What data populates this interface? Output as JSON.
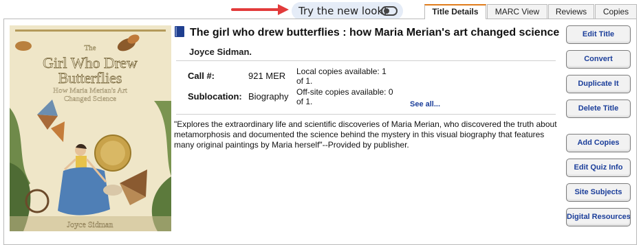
{
  "header": {
    "try_new_look": "Try the new look!",
    "toggle_state": "off"
  },
  "tabs": [
    {
      "label": "Title Details",
      "active": true
    },
    {
      "label": "MARC View",
      "active": false
    },
    {
      "label": "Reviews",
      "active": false
    },
    {
      "label": "Copies",
      "active": false
    }
  ],
  "cover": {
    "line1": "The",
    "line2": "Girl Who Drew",
    "line3": "Butterflies",
    "subtitle1": "How Maria Merian's Art",
    "subtitle2": "Changed Science",
    "author": "Joyce Sidman"
  },
  "record": {
    "title": "The girl who drew butterflies : how Maria Merian's art changed science",
    "author": "Joyce Sidman.",
    "call_label": "Call #:",
    "call_value": "921 MER",
    "subloc_label": "Sublocation:",
    "subloc_value": "Biography",
    "local_copies_1": "Local copies available: 1",
    "local_copies_2": "of 1.",
    "offsite_copies_1": "Off-site copies available: 0",
    "offsite_copies_2": "of 1.",
    "see_all": "See all...",
    "summary": "\"Explores the extraordinary life and scientific discoveries of Maria Merian, who discovered the truth about metamorphosis and documented the science behind the mystery in this visual biography that features many original paintings by Maria herself\"--Provided by publisher."
  },
  "actions": [
    {
      "label": "Edit Title"
    },
    {
      "label": "Convert"
    },
    {
      "label": "Duplicate It"
    },
    {
      "label": "Delete Title"
    },
    {
      "label": "Add Copies"
    },
    {
      "label": "Edit Quiz Info"
    },
    {
      "label": "Site Subjects"
    },
    {
      "label": "Digital Resources"
    }
  ],
  "colors": {
    "accent_tab": "#e07b1a",
    "link": "#1b3e9a",
    "arrow": "#e23b3b",
    "pill_bg": "#e5ecf7"
  }
}
